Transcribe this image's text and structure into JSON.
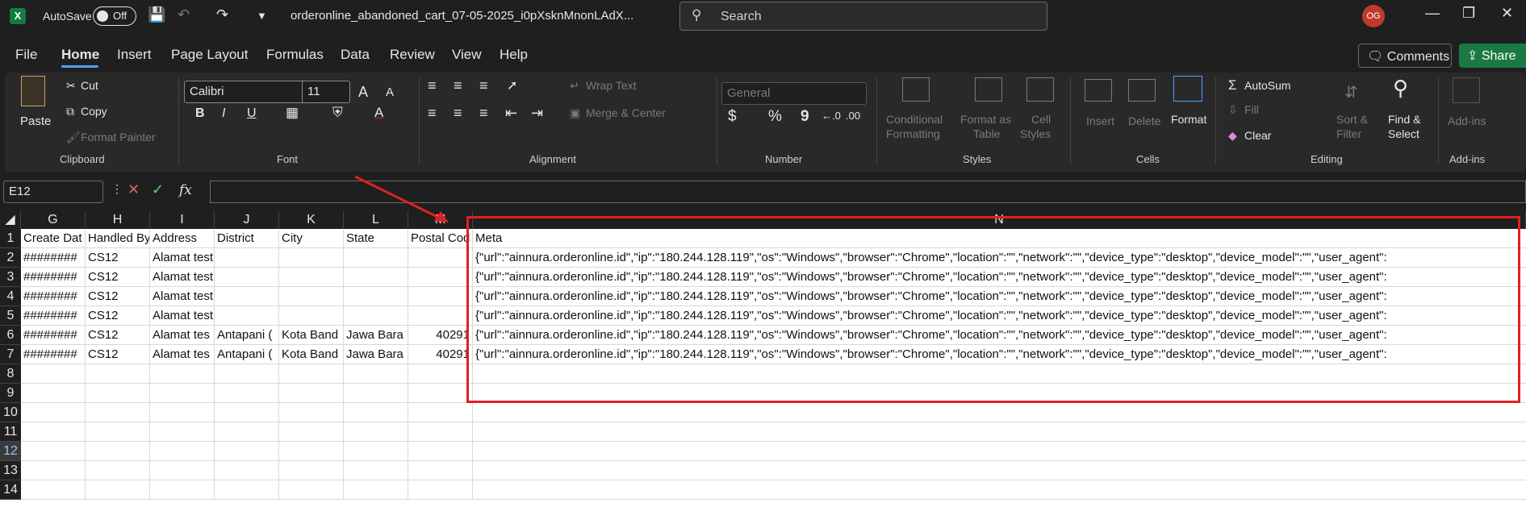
{
  "titlebar": {
    "app_logo": "X",
    "autosave_label": "AutoSave",
    "autosave_state": "Off",
    "filename": "orderonline_abandoned_cart_07-05-2025_i0pXsknMnonLAdX...",
    "search_placeholder": "Search",
    "user_initials": "OG"
  },
  "tabs": [
    "File",
    "Home",
    "Insert",
    "Page Layout",
    "Formulas",
    "Data",
    "Review",
    "View",
    "Help"
  ],
  "comments_label": "Comments",
  "share_label": "Share",
  "ribbon": {
    "clipboard": {
      "paste": "Paste",
      "cut": "Cut",
      "copy": "Copy",
      "format_painter": "Format Painter",
      "label": "Clipboard"
    },
    "font": {
      "name": "Calibri",
      "size": "11",
      "label": "Font",
      "bold": "B",
      "italic": "I",
      "underline": "U",
      "grow": "A",
      "shrink": "A",
      "color": "A"
    },
    "alignment": {
      "wrap": "Wrap Text",
      "merge": "Merge & Center",
      "label": "Alignment"
    },
    "number": {
      "format": "General",
      "label": "Number",
      "currency": "$",
      "percent": "%",
      "comma": "9"
    },
    "styles": {
      "conditional_1": "Conditional",
      "conditional_2": "Formatting",
      "format_as_1": "Format as",
      "format_as_2": "Table",
      "cell_styles_1": "Cell",
      "cell_styles_2": "Styles",
      "label": "Styles"
    },
    "cells": {
      "insert": "Insert",
      "delete": "Delete",
      "format": "Format",
      "label": "Cells"
    },
    "editing": {
      "autosum": "AutoSum",
      "fill": "Fill",
      "clear": "Clear",
      "sort_1": "Sort &",
      "sort_2": "Filter",
      "find_1": "Find &",
      "find_2": "Select",
      "label": "Editing"
    },
    "addins": {
      "button": "Add-ins",
      "label": "Add-ins"
    }
  },
  "formula_bar": {
    "name_box": "E12",
    "fx": "fx",
    "content": ""
  },
  "columns": [
    "G",
    "H",
    "I",
    "J",
    "K",
    "L",
    "M",
    "N"
  ],
  "rows": [
    "1",
    "2",
    "3",
    "4",
    "5",
    "6",
    "7",
    "8",
    "9",
    "10",
    "11",
    "12",
    "13",
    "14"
  ],
  "headers": [
    "Create Dat",
    "Handled By",
    "Address",
    "District",
    "City",
    "State",
    "Postal Cod",
    "Meta"
  ],
  "data_rows": [
    [
      "########",
      "CS12",
      "Alamat test",
      "",
      "",
      "",
      "",
      "{\"url\":\"ainnura.orderonline.id\",\"ip\":\"180.244.128.119\",\"os\":\"Windows\",\"browser\":\"Chrome\",\"location\":\"\",\"network\":\"\",\"device_type\":\"desktop\",\"device_model\":\"\",\"user_agent\":"
    ],
    [
      "########",
      "CS12",
      "Alamat test",
      "",
      "",
      "",
      "",
      "{\"url\":\"ainnura.orderonline.id\",\"ip\":\"180.244.128.119\",\"os\":\"Windows\",\"browser\":\"Chrome\",\"location\":\"\",\"network\":\"\",\"device_type\":\"desktop\",\"device_model\":\"\",\"user_agent\":"
    ],
    [
      "########",
      "CS12",
      "Alamat test",
      "",
      "",
      "",
      "",
      "{\"url\":\"ainnura.orderonline.id\",\"ip\":\"180.244.128.119\",\"os\":\"Windows\",\"browser\":\"Chrome\",\"location\":\"\",\"network\":\"\",\"device_type\":\"desktop\",\"device_model\":\"\",\"user_agent\":"
    ],
    [
      "########",
      "CS12",
      "Alamat test",
      "",
      "",
      "",
      "",
      "{\"url\":\"ainnura.orderonline.id\",\"ip\":\"180.244.128.119\",\"os\":\"Windows\",\"browser\":\"Chrome\",\"location\":\"\",\"network\":\"\",\"device_type\":\"desktop\",\"device_model\":\"\",\"user_agent\":"
    ],
    [
      "########",
      "CS12",
      "Alamat tes",
      "Antapani (",
      "Kota Band",
      "Jawa Bara",
      "40291",
      "{\"url\":\"ainnura.orderonline.id\",\"ip\":\"180.244.128.119\",\"os\":\"Windows\",\"browser\":\"Chrome\",\"location\":\"\",\"network\":\"\",\"device_type\":\"desktop\",\"device_model\":\"\",\"user_agent\":"
    ],
    [
      "########",
      "CS12",
      "Alamat tes",
      "Antapani (",
      "Kota Band",
      "Jawa Bara",
      "40291",
      "{\"url\":\"ainnura.orderonline.id\",\"ip\":\"180.244.128.119\",\"os\":\"Windows\",\"browser\":\"Chrome\",\"location\":\"\",\"network\":\"\",\"device_type\":\"desktop\",\"device_model\":\"\",\"user_agent\":"
    ]
  ],
  "colors": {
    "accent": "#107c41",
    "annotation": "#e02020",
    "share": "#1b7a43"
  }
}
